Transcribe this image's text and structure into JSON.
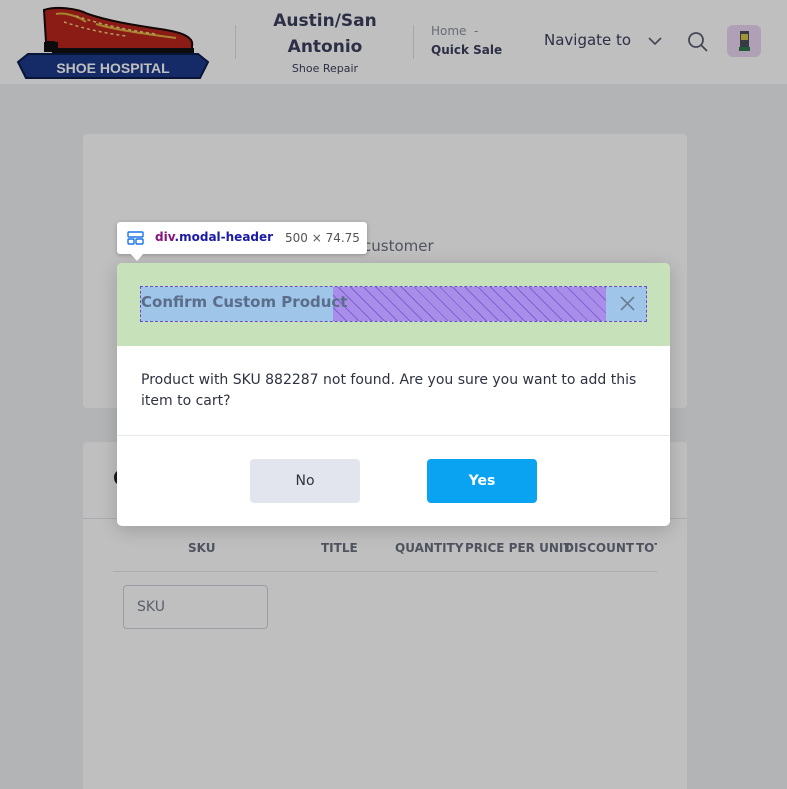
{
  "header": {
    "brand_text": "SHOE HOSPITAL",
    "location_title_line1": "Austin/San",
    "location_title_line2": "Antonio",
    "location_subtitle": "Shoe Repair",
    "breadcrumb_home": "Home",
    "breadcrumb_separator": "-",
    "breadcrumb_current": "Quick Sale",
    "navigate_label": "Navigate to"
  },
  "page": {
    "customer_card_text": "customer",
    "cart_card_heading_fragment": "C",
    "table_headers": [
      "SKU",
      "TITLE",
      "QUANTITY",
      "PRICE PER UNIT",
      "DISCOUNT",
      "TOT"
    ],
    "sku_placeholder": "SKU"
  },
  "modal": {
    "title": "Confirm Custom Product",
    "message": "Product with SKU 882287 not found. Are you sure you want to add this item to cart?",
    "no_label": "No",
    "yes_label": "Yes"
  },
  "devtools_tooltip": {
    "tag": "div",
    "class_name": ".modal-header",
    "size": "500 × 74.75"
  },
  "colors": {
    "modal_header_bg": "#c7e1bb",
    "yes_button": "#0aa3f2",
    "no_button": "#e2e5ee",
    "text_primary": "#3b3f5c"
  }
}
